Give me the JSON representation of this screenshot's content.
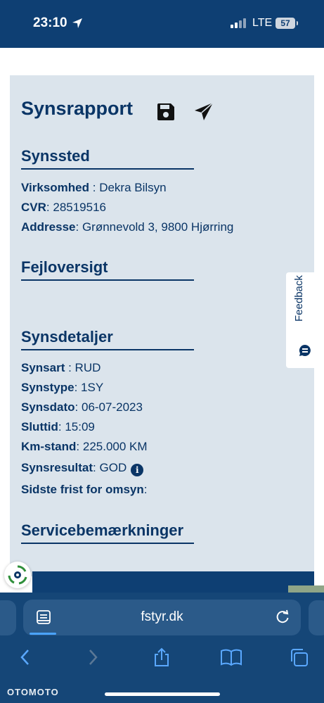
{
  "status_bar": {
    "time": "23:10",
    "network": "LTE",
    "battery": "57"
  },
  "report": {
    "title": "Synsrapport",
    "synssted": {
      "heading": "Synssted",
      "rows": [
        {
          "label": "Virksomhed",
          "sep": " : ",
          "value": "Dekra Bilsyn"
        },
        {
          "label": "CVR",
          "sep": ": ",
          "value": "28519516"
        },
        {
          "label": "Addresse",
          "sep": ": ",
          "value": "Grønnevold 3, 9800 Hjørring"
        }
      ]
    },
    "fejloversigt": {
      "heading": "Fejloversigt"
    },
    "synsdetaljer": {
      "heading": "Synsdetaljer",
      "rows": [
        {
          "label": "Synsart",
          "sep": " : ",
          "value": "RUD"
        },
        {
          "label": "Synstype",
          "sep": ": ",
          "value": "1SY"
        },
        {
          "label": "Synsdato",
          "sep": ": ",
          "value": "06-07-2023"
        },
        {
          "label": "Sluttid",
          "sep": ": ",
          "value": "15:09"
        },
        {
          "label": "Km-stand",
          "sep": ": ",
          "value": "225.000 KM"
        },
        {
          "label": "Synsresultat",
          "sep": ": ",
          "value": "GOD"
        },
        {
          "label": "Sidste frist for omsyn",
          "sep": ":",
          "value": ""
        }
      ]
    },
    "servicebemaerkninger": {
      "heading": "Servicebemærkninger"
    }
  },
  "feedback": {
    "label": "Feedback"
  },
  "browser": {
    "url": "fstyr.dk"
  },
  "watermark": "OTOMOTO"
}
